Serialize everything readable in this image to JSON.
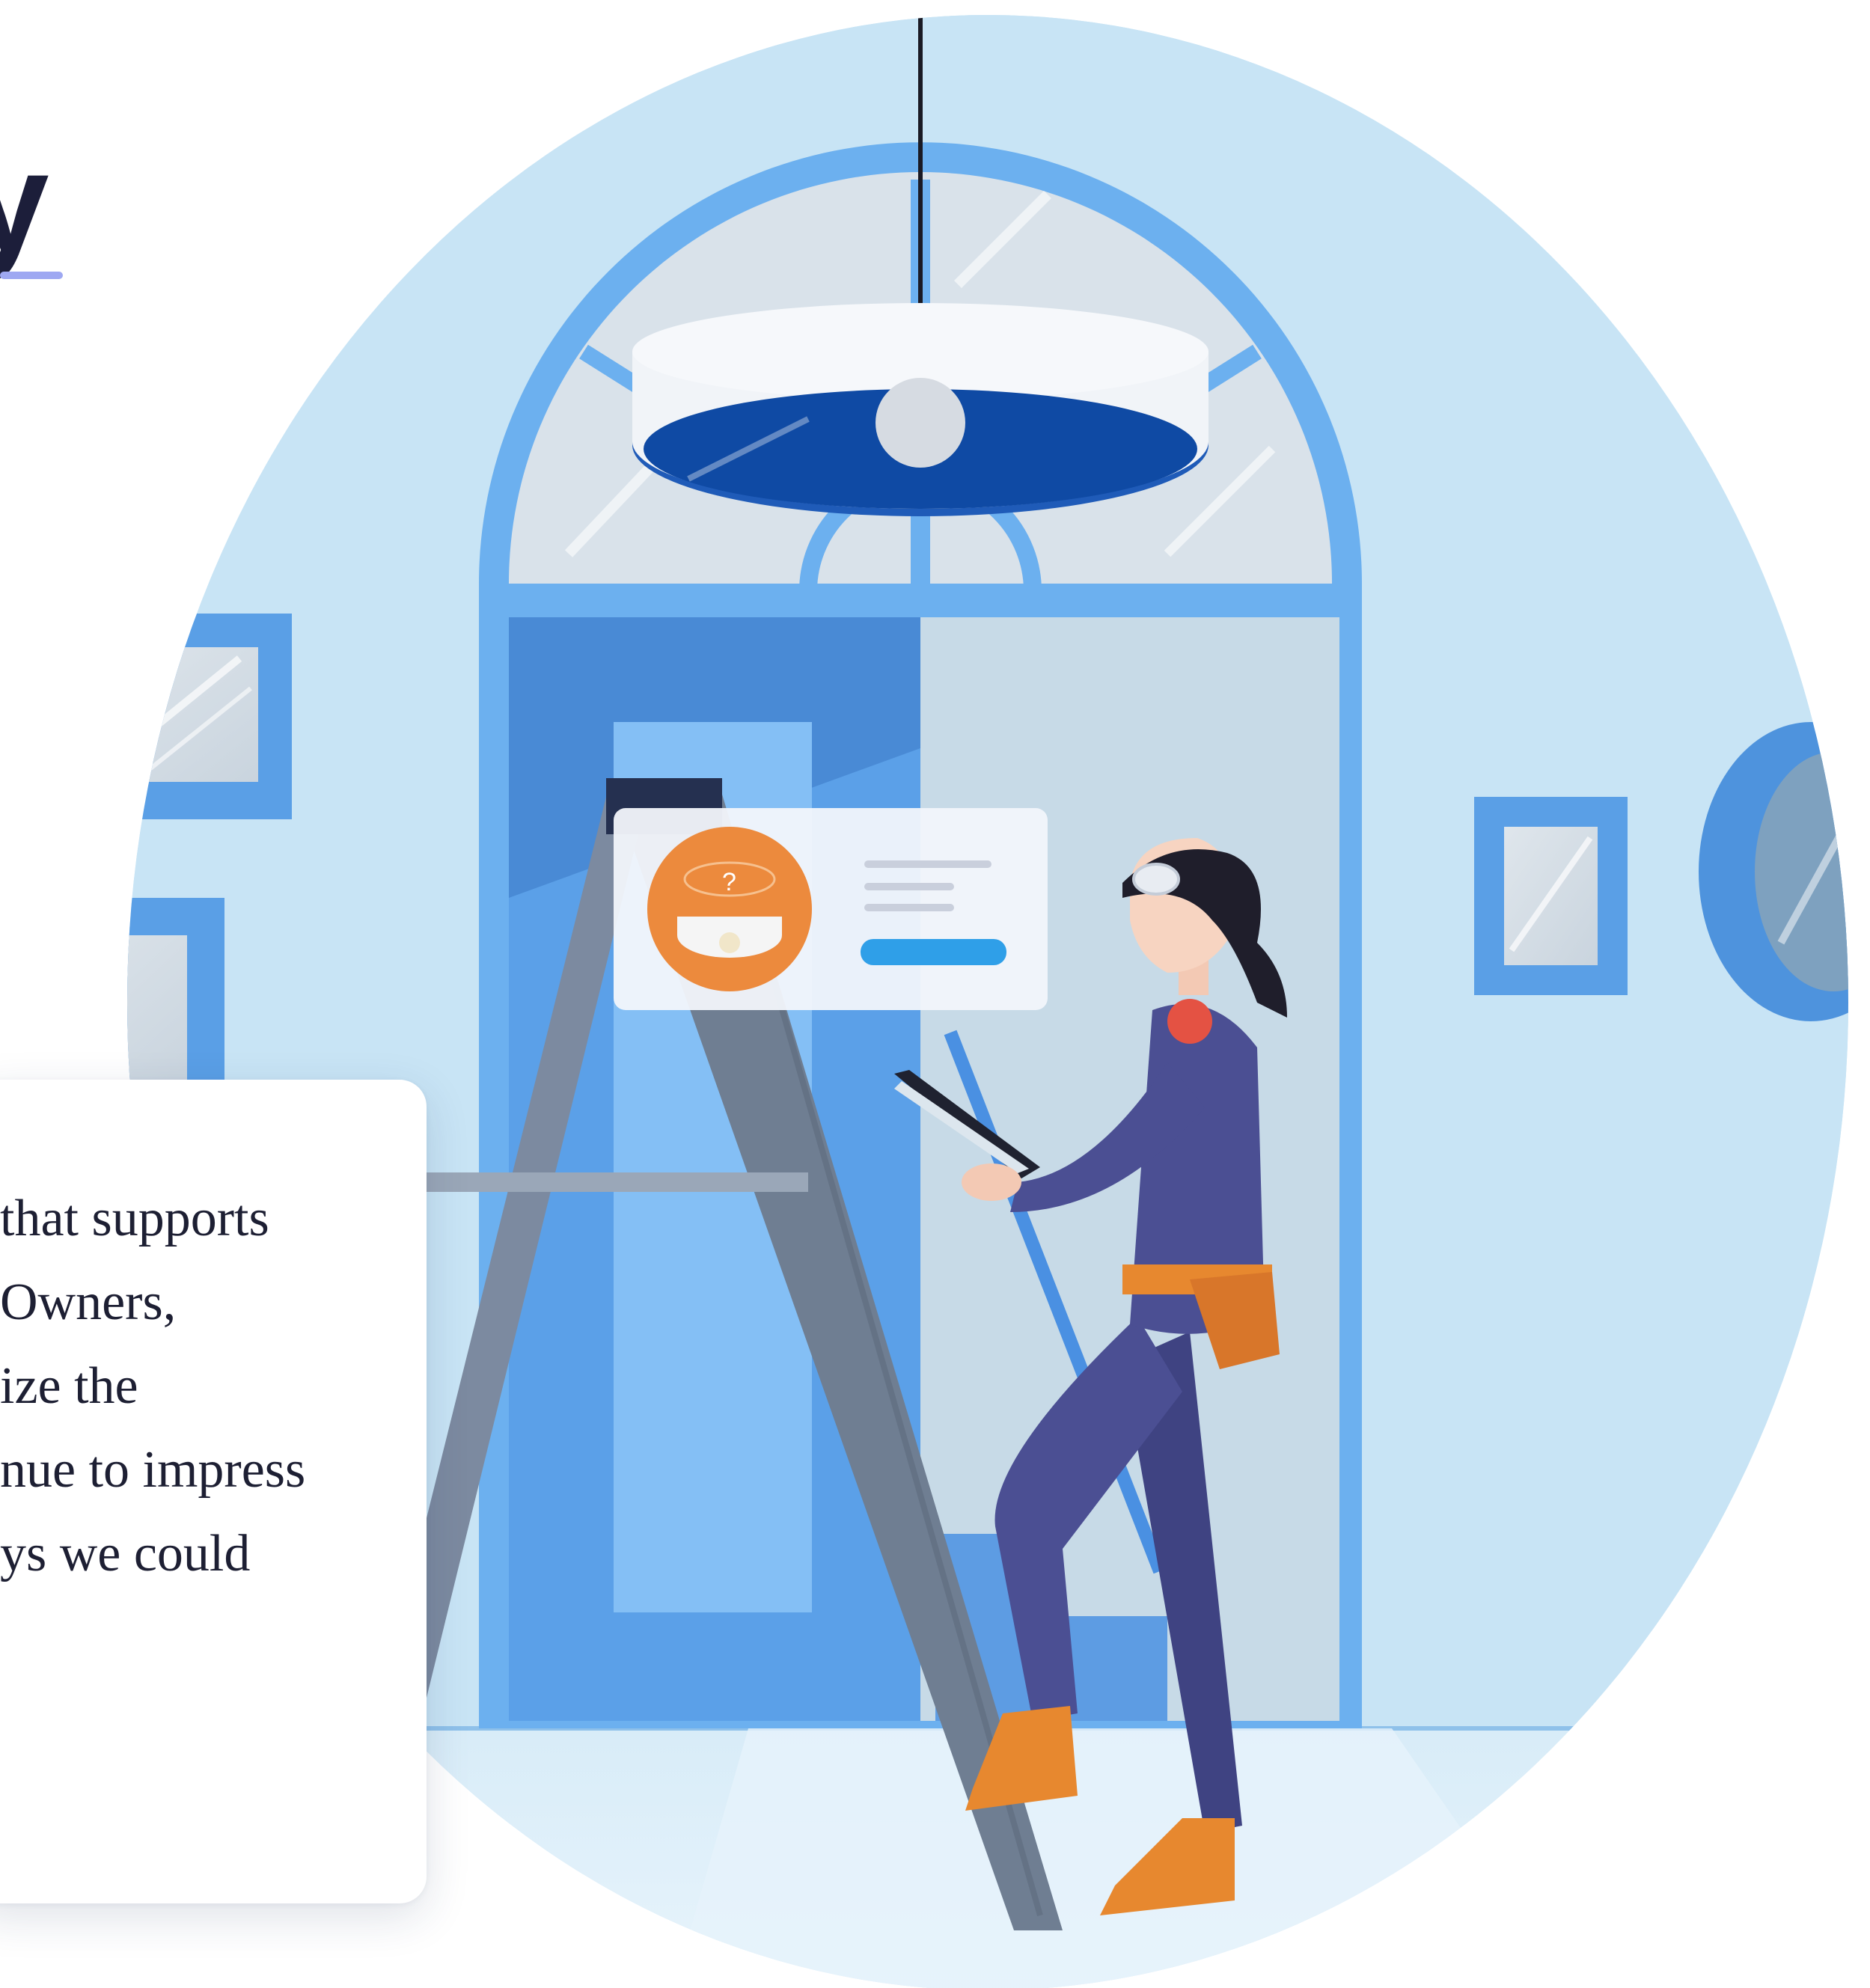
{
  "heading": {
    "visible_fragment": "y"
  },
  "card": {
    "lines": [
      "that supports",
      "Owners,",
      "ize the",
      "nue to impress",
      "ys we could"
    ]
  },
  "colors": {
    "background_circle": "#c4e2f4",
    "wall": "#cbe6f6",
    "door_frame": "#6cb0ef",
    "door_panel": "#5ba0e8",
    "door_dark": "#3a78c4",
    "lamp_shade": "#1f5bb8",
    "lamp_rim": "#f3f6fa",
    "ladder": "#6f7e92",
    "worker_suit": "#4b4f93",
    "boots": "#e7882f",
    "popup_icon": "#ec8a3d",
    "popup_button": "#2f9fe8",
    "heading_text": "#1c1e3a",
    "heading_underline": "#9ea8f2"
  },
  "illustration": {
    "scene": "worker-on-ladder-installing-ceiling-lamp",
    "popup_icon": "ceiling-lamp-question-icon"
  }
}
